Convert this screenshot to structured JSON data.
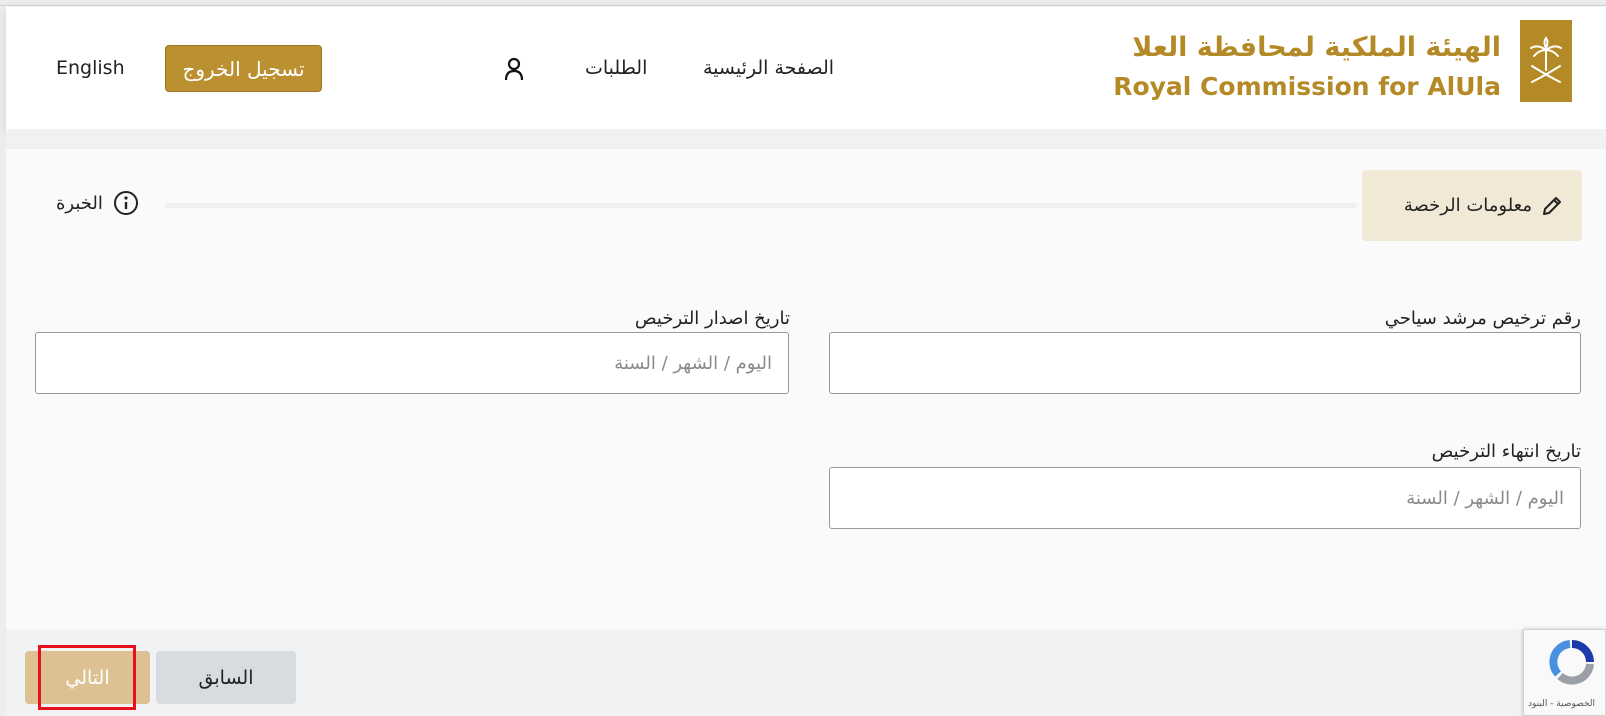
{
  "header": {
    "logo_ar": "الهيئة الملكية لمحافظة العلا",
    "logo_en": "Royal Commission for AlUla",
    "nav_home": "الصفحة الرئيسية",
    "nav_requests": "الطلبات",
    "logout": "تسجيل الخروج",
    "language": "English"
  },
  "stepper": {
    "active_step": "معلومات الرخصة",
    "next_step": "الخبرة"
  },
  "form": {
    "license_number": {
      "label": "رقم ترخيص مرشد سياحي",
      "value": "",
      "placeholder": ""
    },
    "issue_date": {
      "label": "تاريخ اصدار الترخيص",
      "placeholder": "اليوم / الشهر / السنة"
    },
    "expiry_date": {
      "label": "تاريخ انتهاء الترخيص",
      "placeholder": "اليوم / الشهر / السنة"
    }
  },
  "footer": {
    "next": "التالي",
    "previous": "السابق"
  },
  "recaptcha": {
    "text": "الخصوصية - البنود"
  },
  "colors": {
    "brand_gold": "#b48a26",
    "button_gold": "#bb9031",
    "active_step_bg": "#f2e8d6",
    "next_button_bg": "#ddc192",
    "highlight_red": "#e8101a"
  }
}
